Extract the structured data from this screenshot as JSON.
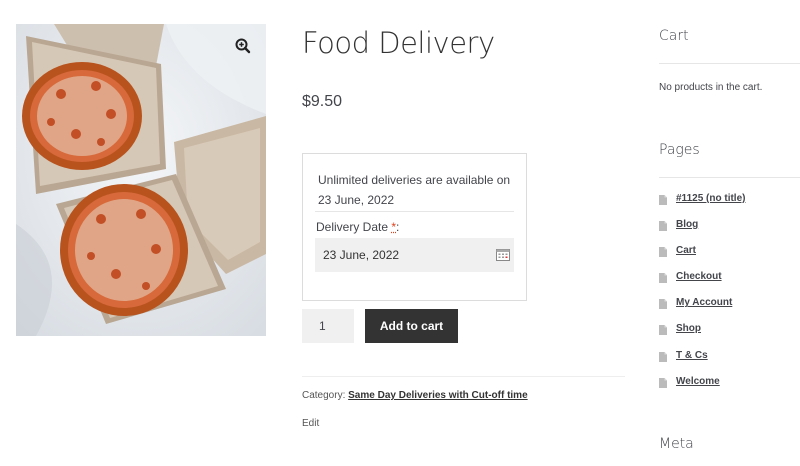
{
  "product": {
    "title": "Food Delivery",
    "price": "$9.50",
    "image_icon": "pizza-image",
    "zoom_icon": "zoom-icon"
  },
  "delivery": {
    "note": "Unlimited deliveries are available on 23 June, 2022",
    "label": "Delivery Date ",
    "required_mark": "*",
    "label_suffix": ":",
    "date_value": "23 June, 2022",
    "calendar_icon": "calendar-icon"
  },
  "cart_form": {
    "quantity": "1",
    "add_to_cart_label": "Add to cart"
  },
  "meta": {
    "category_label": "Category: ",
    "category_link": "Same Day Deliveries with Cut-off time",
    "edit_label": "Edit"
  },
  "sidebar": {
    "cart_title": "Cart",
    "cart_empty": "No products in the cart.",
    "pages_title": "Pages",
    "pages": [
      {
        "label": "#1125 (no title)"
      },
      {
        "label": "Blog"
      },
      {
        "label": "Cart"
      },
      {
        "label": "Checkout"
      },
      {
        "label": "My Account"
      },
      {
        "label": "Shop"
      },
      {
        "label": "T & Cs"
      },
      {
        "label": "Welcome"
      }
    ],
    "meta_title": "Meta"
  },
  "colors": {
    "button_bg": "#333333",
    "required": "#e2401c",
    "input_bg": "#f0f0f0"
  }
}
